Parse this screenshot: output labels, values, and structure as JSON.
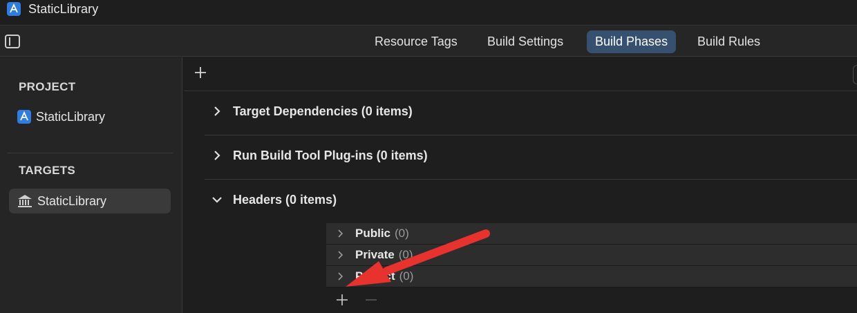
{
  "window": {
    "title": "StaticLibrary"
  },
  "tabs": [
    {
      "label": "Resource Tags",
      "active": false
    },
    {
      "label": "Build Settings",
      "active": false
    },
    {
      "label": "Build Phases",
      "active": true
    },
    {
      "label": "Build Rules",
      "active": false
    }
  ],
  "sidebar": {
    "project_section": "PROJECT",
    "project_item": "StaticLibrary",
    "targets_section": "TARGETS",
    "target_item": "StaticLibrary"
  },
  "phases": [
    {
      "title": "Target Dependencies (0 items)",
      "expanded": false
    },
    {
      "title": "Run Build Tool Plug-ins (0 items)",
      "expanded": false
    },
    {
      "title": "Headers (0 items)",
      "expanded": true
    }
  ],
  "headers": [
    {
      "label": "Public",
      "count": "(0)"
    },
    {
      "label": "Private",
      "count": "(0)"
    },
    {
      "label": "Project",
      "count": "(0)"
    }
  ],
  "colors": {
    "accent_tab": "#36506f",
    "arrow": "#e8322e",
    "app_icon": "#2f7de1"
  },
  "icons": {
    "app": "xcode-app-icon",
    "sidebar_toggle": "sidebar-toggle-icon",
    "library": "library-building-icon",
    "add": "plus-icon",
    "remove": "minus-icon"
  }
}
